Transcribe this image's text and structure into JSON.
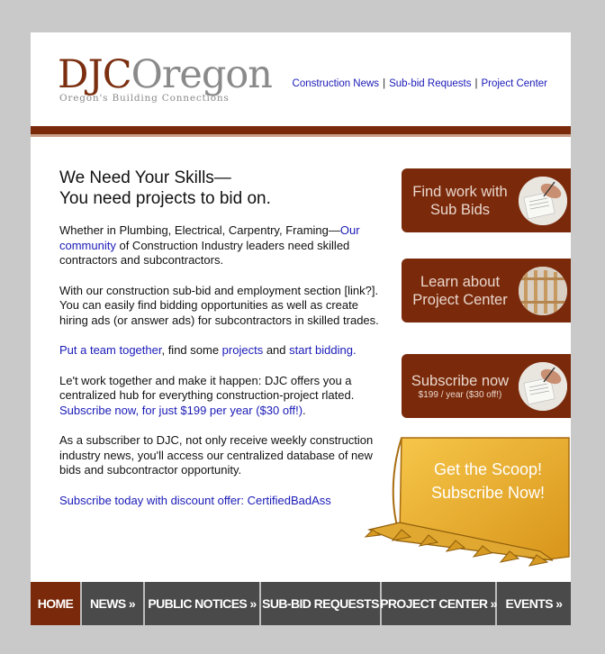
{
  "header": {
    "logo_djc": "DJC",
    "logo_oregon": "Oregon",
    "logo_tagline": "Oregon's Building Connections",
    "links": [
      "Construction News",
      "Sub-bid Requests",
      "Project Center"
    ],
    "separator": "|"
  },
  "main": {
    "headline_line1": "We Need Your Skills—",
    "headline_line2": "You need projects to bid on.",
    "p1_text1": "Whether in Plumbing, Electrical, Carpentry, Framing—",
    "p1_link": "Our community",
    "p1_text2": " of Construction Industry leaders need skilled contractors and subcontractors.",
    "p2_text": "With our construction sub-bid and employment section [link?]. You can easily find bidding opportunities as well as create hiring ads (or answer ads) for subcontractors in skilled trades.",
    "p3_link1": "Put a team together",
    "p3_text1": ", find some ",
    "p3_link2": "projects",
    "p3_text2": " and ",
    "p3_link3": "start bidding.",
    "p4_text": "Le't work together and make it happen: DJC offers you a centralized hub for everything construction-project rlated. ",
    "p4_link": "Subscribe now, for just $199 per year ($30 off!)",
    "p4_end": ".",
    "p5_text": "As a subscriber to DJC, not only receive weekly construction industry news, you'll access our centralized database of new bids and subcontractor opportunity.",
    "p6_link": "Subscribe today with discount offer: CertifiedBadAss"
  },
  "promos": {
    "find_work": {
      "line1": "Find work with",
      "line2": "Sub Bids"
    },
    "project_center": {
      "line1": "Learn about",
      "line2": "Project Center"
    },
    "subscribe": {
      "line1": "Subscribe now",
      "line2": "$199 / year ($30 off!)"
    }
  },
  "scoop": {
    "line1": "Get the Scoop!",
    "line2": "Subscribe Now!"
  },
  "nav": {
    "items": [
      "HOME",
      "NEWS »",
      "PUBLIC NOTICES »",
      "SUB-BID REQUESTS",
      "PROJECT CENTER »",
      "EVENTS »"
    ]
  },
  "colors": {
    "brand": "#7a2a0b",
    "link": "#1a1ab8",
    "nav_bg": "#4a4a4a",
    "bucket": "#f0b428"
  }
}
